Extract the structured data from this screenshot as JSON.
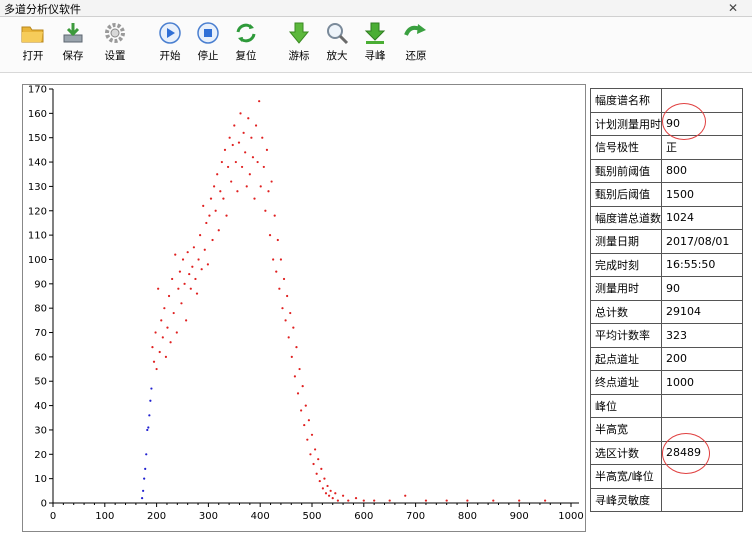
{
  "window": {
    "title": "多道分析仪软件",
    "close_glyph": "✕"
  },
  "toolbar": [
    {
      "id": "open",
      "label": "打开",
      "icon": "folder-icon"
    },
    {
      "id": "save",
      "label": "保存",
      "icon": "save-icon"
    },
    {
      "id": "settings",
      "label": "设置",
      "icon": "gear-icon"
    },
    {
      "id": "start",
      "label": "开始",
      "icon": "play-icon"
    },
    {
      "id": "stop",
      "label": "停止",
      "icon": "stop-icon"
    },
    {
      "id": "reset",
      "label": "复位",
      "icon": "refresh-icon"
    },
    {
      "id": "cursor",
      "label": "游标",
      "icon": "arrow-down-icon"
    },
    {
      "id": "zoom",
      "label": "放大",
      "icon": "magnifier-icon"
    },
    {
      "id": "peak",
      "label": "寻峰",
      "icon": "download-arrow-icon"
    },
    {
      "id": "restore",
      "label": "还原",
      "icon": "curved-arrow-icon"
    }
  ],
  "params": [
    {
      "key": "幅度谱名称",
      "value": ""
    },
    {
      "key": "计划测量用时",
      "value": "90"
    },
    {
      "key": "信号极性",
      "value": "正"
    },
    {
      "key": "甄别前阈值",
      "value": "800"
    },
    {
      "key": "甄别后阈值",
      "value": "1500"
    },
    {
      "key": "幅度谱总道数",
      "value": "1024"
    },
    {
      "key": "测量日期",
      "value": "2017/08/01"
    },
    {
      "key": "完成时刻",
      "value": "16:55:50"
    },
    {
      "key": "测量用时",
      "value": "90"
    },
    {
      "key": "总计数",
      "value": "29104"
    },
    {
      "key": "平均计数率",
      "value": "323"
    },
    {
      "key": "起点道址",
      "value": "200"
    },
    {
      "key": "终点道址",
      "value": "1000"
    },
    {
      "key": "峰位",
      "value": ""
    },
    {
      "key": "半高宽",
      "value": ""
    },
    {
      "key": "选区计数",
      "value": "28489"
    },
    {
      "key": "半高宽/峰位",
      "value": ""
    },
    {
      "key": "寻峰灵敏度",
      "value": ""
    }
  ],
  "colors": {
    "selected_points": "#e02020",
    "unselected_points": "#2020d0",
    "annotation": "#e04040"
  },
  "chart_data": {
    "type": "scatter",
    "xlim": [
      0,
      1000
    ],
    "ylim": [
      0,
      170
    ],
    "x_ticks": [
      0,
      100,
      200,
      300,
      400,
      500,
      600,
      700,
      800,
      900,
      1000
    ],
    "y_ticks": [
      0,
      10,
      20,
      30,
      40,
      50,
      60,
      70,
      80,
      90,
      100,
      110,
      120,
      130,
      140,
      150,
      160,
      170
    ],
    "grid": false,
    "series": [
      {
        "color": "blue",
        "points": [
          [
            172,
            2
          ],
          [
            174,
            5
          ],
          [
            176,
            10
          ],
          [
            178,
            14
          ],
          [
            180,
            20
          ],
          [
            182,
            30
          ],
          [
            184,
            31
          ],
          [
            186,
            36
          ],
          [
            188,
            42
          ],
          [
            190,
            47
          ]
        ]
      },
      {
        "color": "red",
        "points": [
          [
            192,
            64
          ],
          [
            195,
            58
          ],
          [
            198,
            70
          ],
          [
            200,
            55
          ],
          [
            203,
            88
          ],
          [
            206,
            62
          ],
          [
            209,
            75
          ],
          [
            212,
            68
          ],
          [
            215,
            80
          ],
          [
            218,
            60
          ],
          [
            221,
            72
          ],
          [
            224,
            85
          ],
          [
            227,
            66
          ],
          [
            230,
            92
          ],
          [
            233,
            78
          ],
          [
            236,
            102
          ],
          [
            239,
            70
          ],
          [
            242,
            88
          ],
          [
            245,
            95
          ],
          [
            248,
            82
          ],
          [
            251,
            100
          ],
          [
            254,
            90
          ],
          [
            257,
            75
          ],
          [
            260,
            103
          ],
          [
            263,
            94
          ],
          [
            266,
            88
          ],
          [
            269,
            97
          ],
          [
            272,
            105
          ],
          [
            275,
            92
          ],
          [
            278,
            86
          ],
          [
            281,
            100
          ],
          [
            284,
            110
          ],
          [
            287,
            96
          ],
          [
            290,
            122
          ],
          [
            293,
            104
          ],
          [
            296,
            115
          ],
          [
            299,
            98
          ],
          [
            302,
            118
          ],
          [
            305,
            125
          ],
          [
            308,
            108
          ],
          [
            311,
            130
          ],
          [
            314,
            120
          ],
          [
            317,
            135
          ],
          [
            320,
            112
          ],
          [
            323,
            128
          ],
          [
            326,
            140
          ],
          [
            329,
            125
          ],
          [
            332,
            145
          ],
          [
            335,
            118
          ],
          [
            338,
            138
          ],
          [
            341,
            150
          ],
          [
            344,
            132
          ],
          [
            347,
            147
          ],
          [
            350,
            155
          ],
          [
            353,
            140
          ],
          [
            356,
            128
          ],
          [
            359,
            148
          ],
          [
            362,
            160
          ],
          [
            365,
            138
          ],
          [
            368,
            152
          ],
          [
            371,
            144
          ],
          [
            374,
            130
          ],
          [
            377,
            158
          ],
          [
            380,
            135
          ],
          [
            383,
            150
          ],
          [
            386,
            142
          ],
          [
            389,
            125
          ],
          [
            392,
            155
          ],
          [
            395,
            140
          ],
          [
            398,
            165
          ],
          [
            401,
            130
          ],
          [
            404,
            150
          ],
          [
            407,
            138
          ],
          [
            410,
            120
          ],
          [
            413,
            145
          ],
          [
            416,
            128
          ],
          [
            419,
            110
          ],
          [
            422,
            132
          ],
          [
            425,
            100
          ],
          [
            428,
            118
          ],
          [
            431,
            95
          ],
          [
            434,
            108
          ],
          [
            437,
            88
          ],
          [
            440,
            100
          ],
          [
            443,
            80
          ],
          [
            446,
            92
          ],
          [
            449,
            75
          ],
          [
            452,
            85
          ],
          [
            455,
            68
          ],
          [
            458,
            78
          ],
          [
            461,
            60
          ],
          [
            464,
            72
          ],
          [
            467,
            52
          ],
          [
            470,
            64
          ],
          [
            473,
            45
          ],
          [
            476,
            55
          ],
          [
            479,
            38
          ],
          [
            482,
            48
          ],
          [
            485,
            32
          ],
          [
            488,
            40
          ],
          [
            491,
            26
          ],
          [
            494,
            34
          ],
          [
            497,
            20
          ],
          [
            500,
            28
          ],
          [
            503,
            16
          ],
          [
            506,
            22
          ],
          [
            509,
            12
          ],
          [
            512,
            18
          ],
          [
            515,
            9
          ],
          [
            518,
            14
          ],
          [
            521,
            6
          ],
          [
            524,
            10
          ],
          [
            527,
            4
          ],
          [
            530,
            7
          ],
          [
            533,
            3
          ],
          [
            536,
            5
          ],
          [
            540,
            2
          ],
          [
            545,
            4
          ],
          [
            550,
            1
          ],
          [
            560,
            3
          ],
          [
            570,
            1
          ],
          [
            585,
            2
          ],
          [
            600,
            1
          ],
          [
            620,
            1
          ],
          [
            650,
            1
          ],
          [
            680,
            3
          ],
          [
            720,
            1
          ],
          [
            760,
            1
          ],
          [
            800,
            1
          ],
          [
            850,
            1
          ],
          [
            900,
            1
          ],
          [
            950,
            1
          ]
        ]
      }
    ]
  }
}
